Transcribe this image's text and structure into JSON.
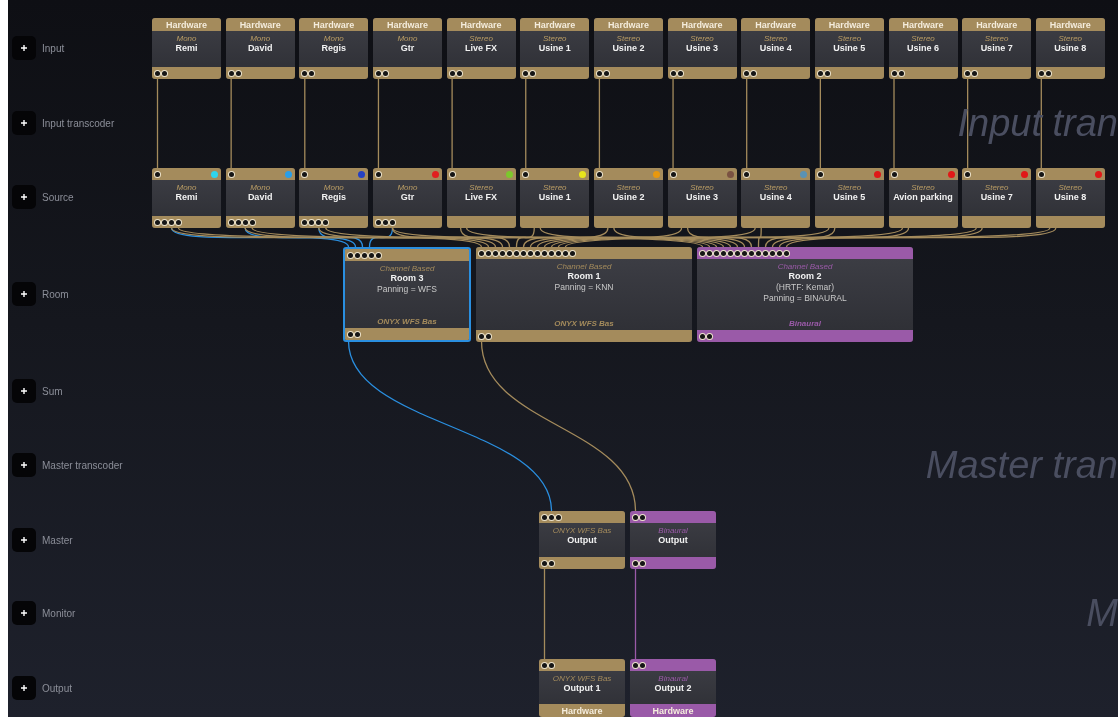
{
  "stages": [
    {
      "label": "Input"
    },
    {
      "label": "Input transcoder",
      "watermark": "Input tran"
    },
    {
      "label": "Source"
    },
    {
      "label": "Room"
    },
    {
      "label": "Sum"
    },
    {
      "label": "Master transcoder",
      "watermark": "Master tran"
    },
    {
      "label": "Master"
    },
    {
      "label": "Monitor",
      "watermark": "M"
    },
    {
      "label": "Output"
    }
  ],
  "inputs": [
    {
      "header": "Hardware",
      "type": "Mono",
      "name": "Remi"
    },
    {
      "header": "Hardware",
      "type": "Mono",
      "name": "David"
    },
    {
      "header": "Hardware",
      "type": "Mono",
      "name": "Regis"
    },
    {
      "header": "Hardware",
      "type": "Mono",
      "name": "Gtr"
    },
    {
      "header": "Hardware",
      "type": "Stereo",
      "name": "Live FX"
    },
    {
      "header": "Hardware",
      "type": "Stereo",
      "name": "Usine 1"
    },
    {
      "header": "Hardware",
      "type": "Stereo",
      "name": "Usine 2"
    },
    {
      "header": "Hardware",
      "type": "Stereo",
      "name": "Usine 3"
    },
    {
      "header": "Hardware",
      "type": "Stereo",
      "name": "Usine 4"
    },
    {
      "header": "Hardware",
      "type": "Stereo",
      "name": "Usine 5"
    },
    {
      "header": "Hardware",
      "type": "Stereo",
      "name": "Usine 6"
    },
    {
      "header": "Hardware",
      "type": "Stereo",
      "name": "Usine 7"
    },
    {
      "header": "Hardware",
      "type": "Stereo",
      "name": "Usine 8"
    }
  ],
  "sources": [
    {
      "type": "Mono",
      "name": "Remi",
      "color": "#2fd4ec"
    },
    {
      "type": "Mono",
      "name": "David",
      "color": "#2a9ee8"
    },
    {
      "type": "Mono",
      "name": "Regis",
      "color": "#2440c4"
    },
    {
      "type": "Mono",
      "name": "Gtr",
      "color": "#e02020"
    },
    {
      "type": "Stereo",
      "name": "Live FX",
      "color": "#7cc82c"
    },
    {
      "type": "Stereo",
      "name": "Usine 1",
      "color": "#e8e41c"
    },
    {
      "type": "Stereo",
      "name": "Usine 2",
      "color": "#e8980e"
    },
    {
      "type": "Stereo",
      "name": "Usine 3",
      "color": "#7a5242"
    },
    {
      "type": "Stereo",
      "name": "Usine 4",
      "color": "#5a92b4"
    },
    {
      "type": "Stereo",
      "name": "Usine 5",
      "color": "#e01818"
    },
    {
      "type": "Stereo",
      "name": "Avion parking",
      "color": "#e01818"
    },
    {
      "type": "Stereo",
      "name": "Usine 7",
      "color": "#e01818"
    },
    {
      "type": "Stereo",
      "name": "Usine 8",
      "color": "#e01818"
    }
  ],
  "rooms": [
    {
      "type": "Channel Based",
      "name": "Room  3",
      "details": [
        "Panning = WFS"
      ],
      "footer": "ONYX WFS Bas",
      "color": "#a48b5c",
      "selected": true
    },
    {
      "type": "Channel Based",
      "name": "Room 1",
      "details": [
        "Panning = KNN"
      ],
      "footer": "ONYX WFS Bas",
      "color": "#a48b5c",
      "selected": false
    },
    {
      "type": "Channel Based",
      "name": "Room 2",
      "details": [
        "(HRTF: Kemar)",
        "Panning = BINAURAL"
      ],
      "footer": "Binaural",
      "color": "#9a5aa8",
      "selected": false
    }
  ],
  "masters": [
    {
      "type": "ONYX WFS Bas",
      "name": "Output",
      "color": "#a48b5c"
    },
    {
      "type": "Binaural",
      "name": "Output",
      "color": "#9a5aa8"
    }
  ],
  "outputs": [
    {
      "type": "ONYX WFS Bas",
      "name": "Output 1",
      "footer": "Hardware",
      "color": "#a48b5c"
    },
    {
      "type": "Binaural",
      "name": "Output 2",
      "footer": "Hardware",
      "color": "#9a5aa8"
    }
  ]
}
